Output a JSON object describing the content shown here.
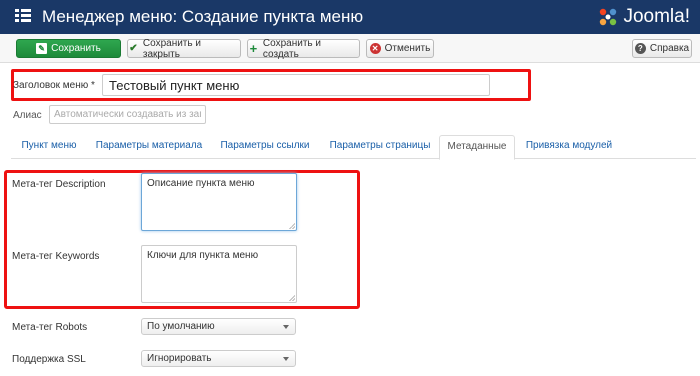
{
  "header": {
    "title": "Менеджер меню: Создание пункта меню",
    "logo_text": "Joomla!"
  },
  "toolbar": {
    "save": "Сохранить",
    "save_close": "Сохранить и закрыть",
    "save_new": "Сохранить и создать",
    "cancel": "Отменить",
    "help": "Справка"
  },
  "form": {
    "title_label": "Заголовок меню *",
    "title_value": "Тестовый пункт меню",
    "alias_label": "Алиас",
    "alias_placeholder": "Автоматически создавать из заго"
  },
  "tabs": [
    {
      "label": "Пункт меню",
      "active": false
    },
    {
      "label": "Параметры материала",
      "active": false
    },
    {
      "label": "Параметры ссылки",
      "active": false
    },
    {
      "label": "Параметры страницы",
      "active": false
    },
    {
      "label": "Метаданные",
      "active": true
    },
    {
      "label": "Привязка модулей",
      "active": false
    }
  ],
  "metadata": {
    "description_label": "Мета-тег Description",
    "description_value": "Описание пункта меню",
    "keywords_label": "Мета-тег Keywords",
    "keywords_value": "Ключи для пункта меню",
    "robots_label": "Мета-тег Robots",
    "robots_value": "По умолчанию",
    "ssl_label": "Поддержка SSL",
    "ssl_value": "Игнорировать"
  },
  "colors": {
    "header_bg": "#1a3867",
    "save_btn": "#2fa74f",
    "highlight": "#ee1111",
    "link": "#1a5fa8"
  }
}
